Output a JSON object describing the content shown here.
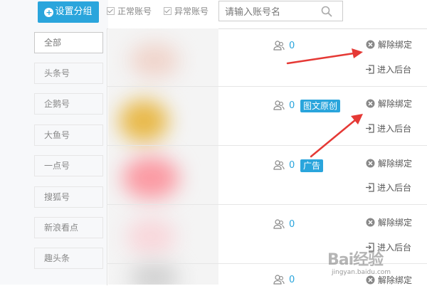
{
  "toolbar": {
    "set_group_label": "设置分组",
    "normal_label": "正常账号",
    "abnormal_label": "异常账号",
    "search_placeholder": "请输入账号名"
  },
  "categories": [
    {
      "label": "全部",
      "active": true
    },
    {
      "label": "头条号"
    },
    {
      "label": "企鹅号"
    },
    {
      "label": "大鱼号"
    },
    {
      "label": "一点号"
    },
    {
      "label": "搜狐号"
    },
    {
      "label": "新浪看点"
    },
    {
      "label": "趣头条"
    }
  ],
  "rows": [
    {
      "count": "0",
      "unbind_label": "解除绑定",
      "backend_label": "进入后台"
    },
    {
      "count": "0",
      "badge": "图文原创",
      "unbind_label": "解除绑定",
      "backend_label": "进入后台"
    },
    {
      "count": "0",
      "badge": "广告",
      "unbind_label": "解除绑定",
      "backend_label": "进入后台"
    },
    {
      "count": "0",
      "unbind_label": "解除绑定",
      "backend_label": "进入后台"
    },
    {
      "count": "0",
      "unbind_label": "解除绑定"
    }
  ],
  "watermark": {
    "logo": "Bai经验",
    "url": "jingyan.baidu.com"
  },
  "colors": {
    "accent": "#2aa5dc",
    "arrow": "#e53935",
    "panel_bg": "#f7f8fa"
  }
}
